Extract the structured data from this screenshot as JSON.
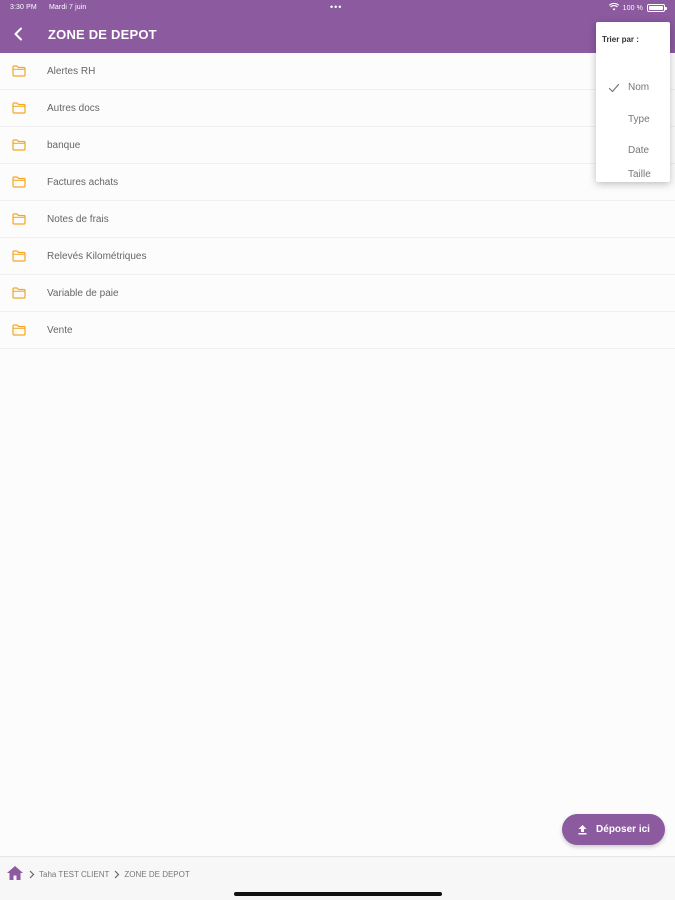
{
  "status": {
    "time": "3:30 PM",
    "date": "Mardi 7 juin",
    "dots": "•••",
    "battery_text": "100 %"
  },
  "header": {
    "title": "ZONE DE DEPOT"
  },
  "folders": [
    "Alertes RH",
    "Autres docs",
    "banque",
    "Factures achats",
    "Notes de frais",
    "Relevés Kilométriques",
    "Variable de paie",
    "Vente"
  ],
  "sort_menu": {
    "title": "Trier par :",
    "options": [
      "Nom",
      "Type",
      "Date",
      "Taille"
    ],
    "selected": "Nom"
  },
  "fab": {
    "label": "Déposer ici"
  },
  "breadcrumb": {
    "items": [
      "Taha TEST CLIENT",
      "ZONE DE DEPOT"
    ]
  },
  "colors": {
    "accent": "#8b5a9f",
    "folder": "#f5a623"
  }
}
